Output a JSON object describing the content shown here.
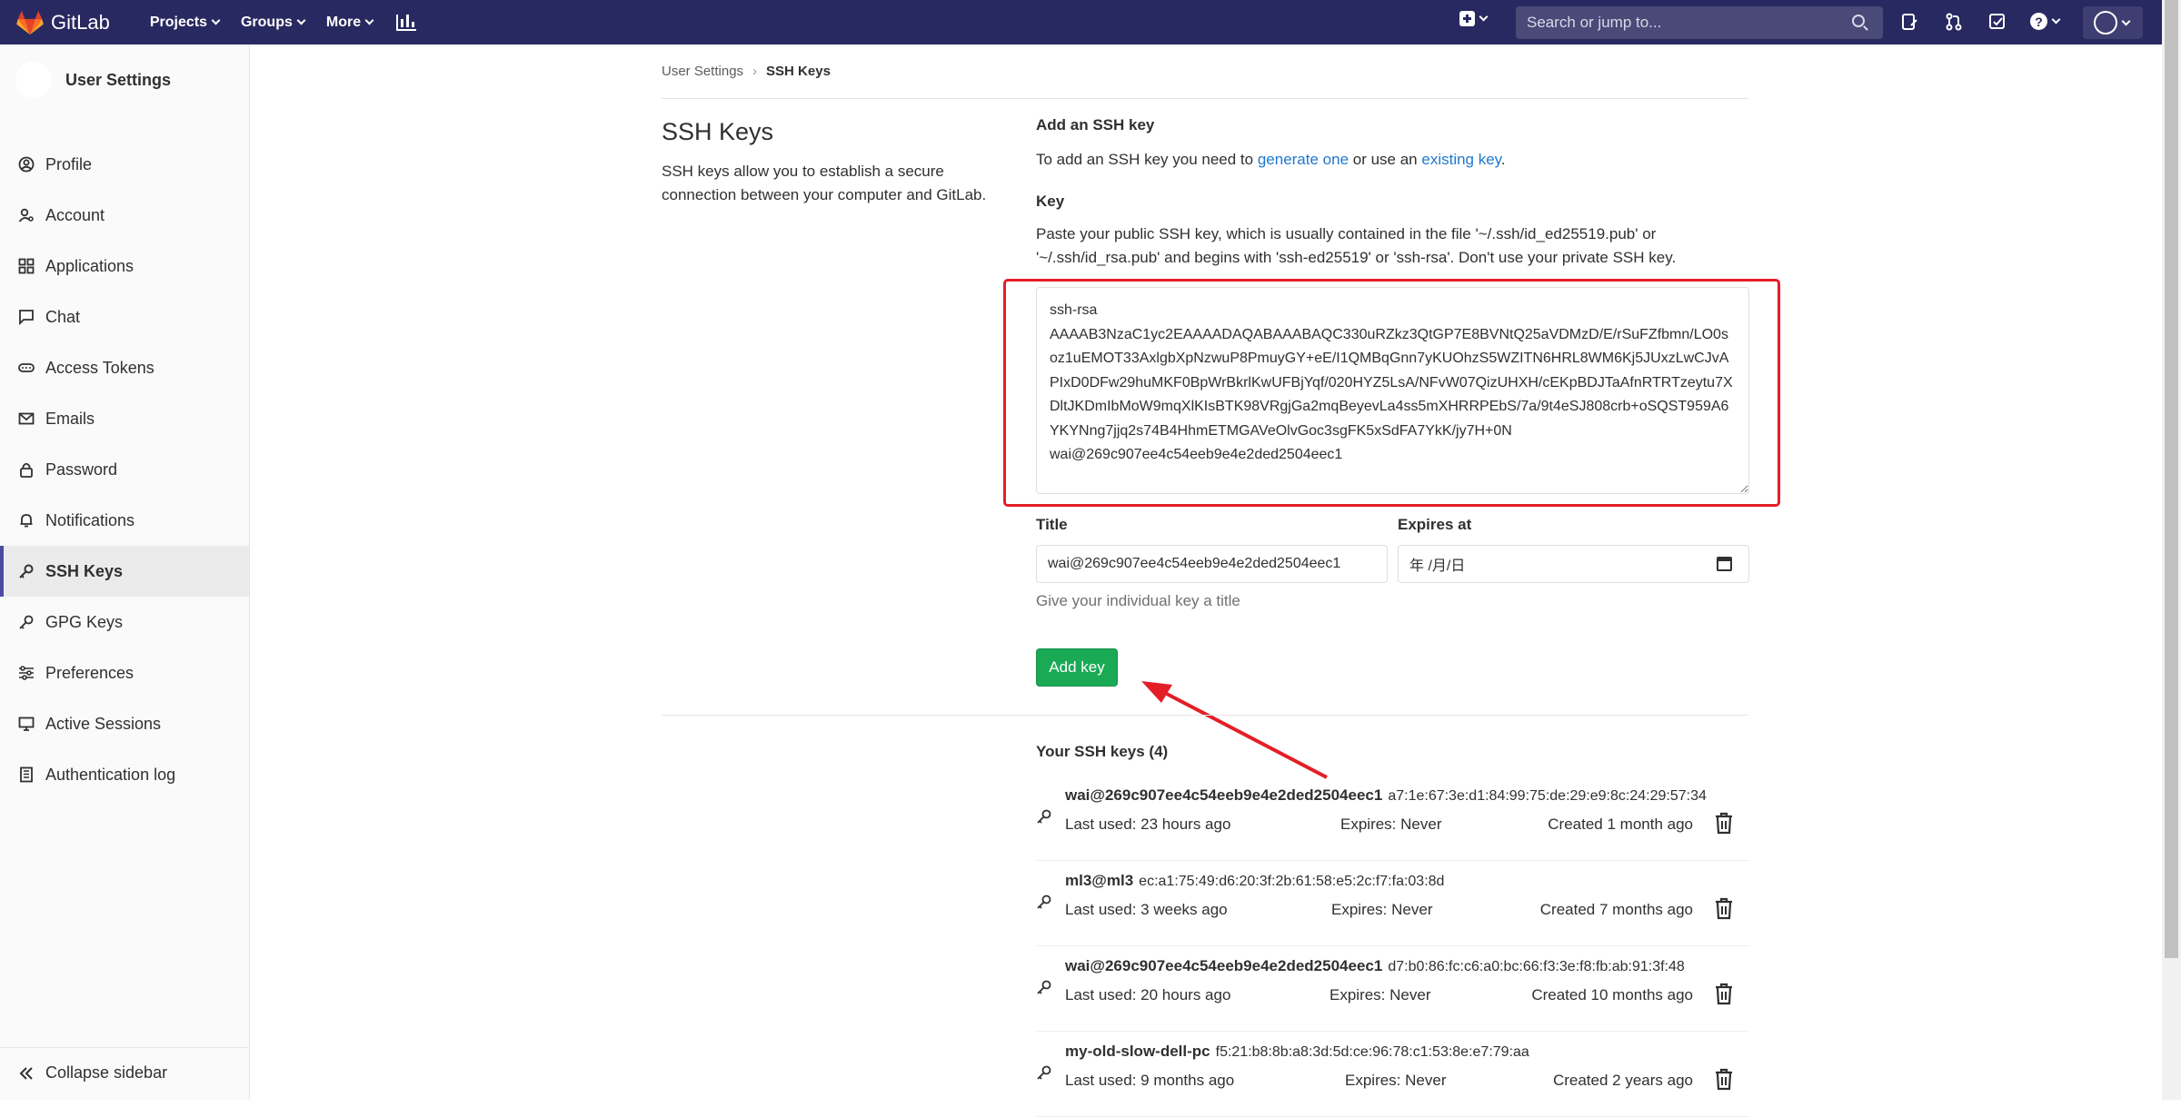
{
  "topbar": {
    "brand": "GitLab",
    "nav": [
      {
        "label": "Projects"
      },
      {
        "label": "Groups"
      },
      {
        "label": "More"
      }
    ],
    "search_placeholder": "Search or jump to..."
  },
  "sidebar": {
    "title": "User Settings",
    "items": [
      {
        "label": "Profile",
        "icon": "profile-icon"
      },
      {
        "label": "Account",
        "icon": "account-icon"
      },
      {
        "label": "Applications",
        "icon": "applications-icon"
      },
      {
        "label": "Chat",
        "icon": "chat-icon"
      },
      {
        "label": "Access Tokens",
        "icon": "access-tokens-icon"
      },
      {
        "label": "Emails",
        "icon": "email-icon"
      },
      {
        "label": "Password",
        "icon": "lock-icon"
      },
      {
        "label": "Notifications",
        "icon": "bell-icon"
      },
      {
        "label": "SSH Keys",
        "icon": "key-icon",
        "active": true
      },
      {
        "label": "GPG Keys",
        "icon": "key-icon"
      },
      {
        "label": "Preferences",
        "icon": "preferences-icon"
      },
      {
        "label": "Active Sessions",
        "icon": "monitor-icon"
      },
      {
        "label": "Authentication log",
        "icon": "log-icon"
      }
    ],
    "collapse_label": "Collapse sidebar"
  },
  "breadcrumb": {
    "parent": "User Settings",
    "current": "SSH Keys"
  },
  "page": {
    "title": "SSH Keys",
    "description": "SSH keys allow you to establish a secure connection between your computer and GitLab."
  },
  "add_key": {
    "heading": "Add an SSH key",
    "intro_prefix": "To add an SSH key you need to ",
    "generate_link": "generate one",
    "intro_middle": " or use an ",
    "existing_link": "existing key",
    "intro_suffix": ".",
    "key_label": "Key",
    "key_help_line1": "Paste your public SSH key, which is usually contained in the file '~/.ssh/id_ed25519.pub' or",
    "key_help_line2": "'~/.ssh/id_rsa.pub' and begins with 'ssh-ed25519' or 'ssh-rsa'. Don't use your private SSH key.",
    "key_value": "ssh-rsa\nAAAAB3NzaC1yc2EAAAADAQABAAABAQC330uRZkz3QtGP7E8BVNtQ25aVDMzD/E/rSuFZfbmn/LO0soz1uEMOT33AxlgbXpNzwuP8PmuyGY+eE/I1QMBqGnn7yKUOhzS5WZITN6HRL8WM6Kj5JUxzLwCJvAPIxD0DFw29huMKF0BpWrBkrlKwUFBjYqf/020HYZ5LsA/NFvW07QizUHXH/cEKpBDJTaAfnRTRTzeytu7XDltJKDmIbMoW9mqXlKIsBTK98VRgjGa2mqBeyevLa4ss5mXHRRPEbS/7a/9t4eSJ808crb+oSQST959A6YKYNng7jjq2s74B4HhmETMGAVeOlvGoc3sgFK5xSdFA7YkK/jy7H+0N\nwai@269c907ee4c54eeb9e4e2ded2504eec1",
    "title_label": "Title",
    "title_value": "wai@269c907ee4c54eeb9e4e2ded2504eec1",
    "expires_label": "Expires at",
    "expires_placeholder": "年 /月/日",
    "title_hint": "Give your individual key a title",
    "submit_label": "Add key"
  },
  "keys": {
    "heading": "Your SSH keys (4)",
    "list": [
      {
        "name": "wai@269c907ee4c54eeb9e4e2ded2504eec1",
        "fingerprint": "a7:1e:67:3e:d1:84:99:75:de:29:e9:8c:24:29:57:34",
        "last_used": "Last used: 23 hours ago",
        "expires": "Expires: Never",
        "created": "Created 1 month ago"
      },
      {
        "name": "ml3@ml3",
        "fingerprint": "ec:a1:75:49:d6:20:3f:2b:61:58:e5:2c:f7:fa:03:8d",
        "last_used": "Last used: 3 weeks ago",
        "expires": "Expires: Never",
        "created": "Created 7 months ago"
      },
      {
        "name": "wai@269c907ee4c54eeb9e4e2ded2504eec1",
        "fingerprint": "d7:b0:86:fc:c6:a0:bc:66:f3:3e:f8:fb:ab:91:3f:48",
        "last_used": "Last used: 20 hours ago",
        "expires": "Expires: Never",
        "created": "Created 10 months ago"
      },
      {
        "name": "my-old-slow-dell-pc",
        "fingerprint": "f5:21:b8:8b:a8:3d:5d:ce:96:78:c1:53:8e:e7:79:aa",
        "last_used": "Last used: 9 months ago",
        "expires": "Expires: Never",
        "created": "Created 2 years ago"
      }
    ]
  },
  "colors": {
    "topbar": "#292961",
    "accent_green": "#1aaa55",
    "link": "#1f78d1",
    "highlight_red": "#e41e26"
  }
}
